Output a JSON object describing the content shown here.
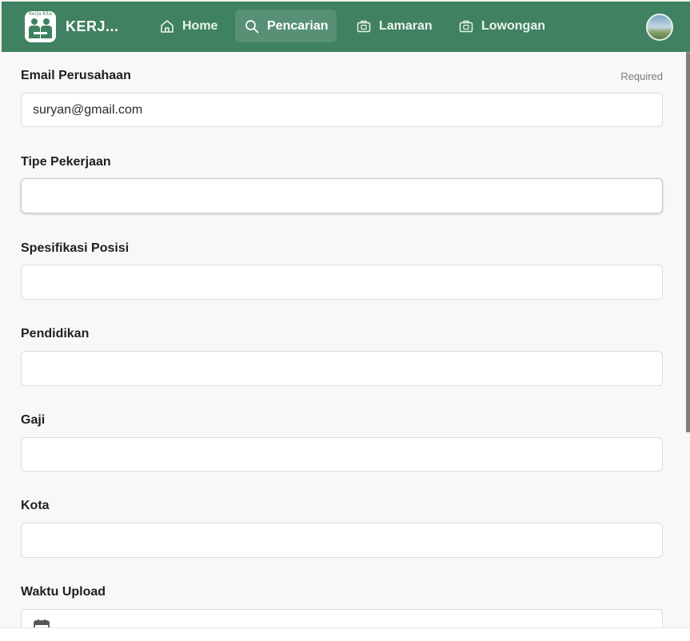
{
  "navbar": {
    "logo_caption": "Kerja Kita",
    "brand": "KERJ...",
    "items": [
      {
        "label": "Home",
        "icon": "home-icon"
      },
      {
        "label": "Pencarian",
        "icon": "search-icon",
        "active": true
      },
      {
        "label": "Lamaran",
        "icon": "briefcase-icon"
      },
      {
        "label": "Lowongan",
        "icon": "briefcase-icon"
      }
    ]
  },
  "form": {
    "email": {
      "label": "Email Perusahaan",
      "required": "Required",
      "value": "suryan@gmail.com"
    },
    "tipe": {
      "label": "Tipe Pekerjaan",
      "value": ""
    },
    "spesifikasi": {
      "label": "Spesifikasi Posisi",
      "value": ""
    },
    "pendidikan": {
      "label": "Pendidikan",
      "value": ""
    },
    "gaji": {
      "label": "Gaji",
      "value": ""
    },
    "kota": {
      "label": "Kota",
      "value": ""
    },
    "waktu": {
      "label": "Waktu Upload",
      "value": "",
      "icon": "calendar-icon"
    }
  },
  "colors": {
    "accent": "#3f8160",
    "active_tab": "#579075"
  }
}
